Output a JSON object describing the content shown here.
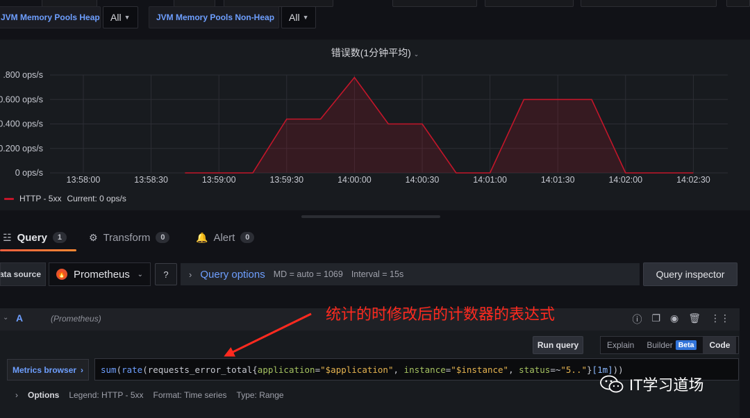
{
  "variables": [
    {
      "label": "JVM Memory Pools Heap",
      "value": "All"
    },
    {
      "label": "JVM Memory Pools Non-Heap",
      "value": "All"
    }
  ],
  "panel": {
    "title": "错误数(1分钟平均)",
    "legend": {
      "series": "HTTP - 5xx",
      "current": "Current: 0 ops/s"
    }
  },
  "chart_data": {
    "type": "area",
    "title": "错误数(1分钟平均)",
    "ylabel": "",
    "xlabel": "",
    "x_ticks": [
      "13:58:00",
      "13:58:30",
      "13:59:00",
      "13:59:30",
      "14:00:00",
      "14:00:30",
      "14:01:00",
      "14:01:30",
      "14:02:00",
      "14:02:30"
    ],
    "y_ticks": [
      ".800 ops/s",
      "0.600 ops/s",
      "0.400 ops/s",
      "0.200 ops/s",
      "0 ops/s"
    ],
    "ylim": [
      0,
      0.8
    ],
    "series": [
      {
        "name": "HTTP - 5xx",
        "color": "#c4162a",
        "x": [
          "13:58:45",
          "13:59:00",
          "13:59:15",
          "13:59:30",
          "13:59:45",
          "14:00:00",
          "14:00:15",
          "14:00:30",
          "14:00:45",
          "14:01:00",
          "14:01:15",
          "14:01:30",
          "14:01:45",
          "14:02:00",
          "14:02:15",
          "14:02:30"
        ],
        "values": [
          0,
          0,
          0,
          0.44,
          0.44,
          0.78,
          0.4,
          0.4,
          0,
          0,
          0.6,
          0.6,
          0.6,
          0,
          0,
          0
        ]
      }
    ]
  },
  "tabs": [
    {
      "label": "Query",
      "count": "1",
      "icon": "database-icon"
    },
    {
      "label": "Transform",
      "count": "0",
      "icon": "transform-icon"
    },
    {
      "label": "Alert",
      "count": "0",
      "icon": "bell-icon"
    }
  ],
  "datasource": {
    "label": "Data source",
    "name": "Prometheus",
    "query_options_label": "Query options",
    "md": "MD = auto = 1069",
    "interval": "Interval = 15s",
    "inspector": "Query inspector"
  },
  "query": {
    "ref": "A",
    "datasource_hint": "(Prometheus)",
    "run_label": "Run query",
    "modes": {
      "explain": "Explain",
      "builder": "Builder",
      "beta": "Beta",
      "code": "Code"
    },
    "metrics_browser": "Metrics browser",
    "expr_tokens": {
      "fn1": "sum",
      "p1": "(",
      "fn2": "rate",
      "p2": "(",
      "metric": "requests_error_total",
      "b1": "{",
      "l1": "application",
      "eq1": "=",
      "s1": "\"$application\"",
      "c1": ", ",
      "l2": "instance",
      "eq2": "=",
      "s2": "\"$instance\"",
      "c2": ", ",
      "l3": "status",
      "eq3": "=~",
      "s3": "\"5..\"",
      "b2": "}",
      "r": "[1m]",
      "p3": "))"
    },
    "options": {
      "title": "Options",
      "legend": "Legend: HTTP - 5xx",
      "format": "Format: Time series",
      "type": "Type: Range"
    }
  },
  "annotation": {
    "text": "统计的时修改后的计数器的表达式",
    "color": "#ff2a1f"
  },
  "watermark": {
    "text": "IT学习道场"
  }
}
